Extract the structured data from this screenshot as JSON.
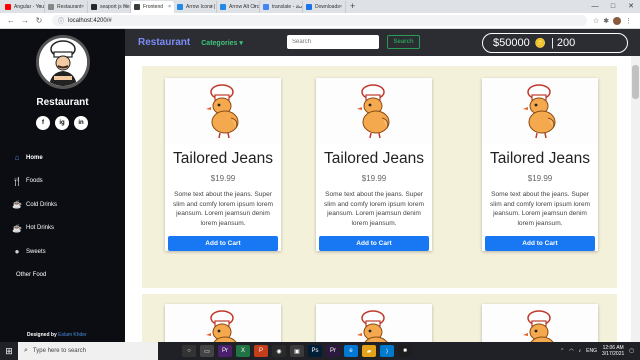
{
  "browser": {
    "tabs": [
      {
        "title": "Angular - YouTube",
        "color": "#ff0000"
      },
      {
        "title": "Restaurant",
        "color": "#888888"
      },
      {
        "title": "seaport js files - bo",
        "color": "#24292e"
      },
      {
        "title": "Frontend",
        "color": "#3c3c3c",
        "active": true
      },
      {
        "title": "Arrow Icons | Font",
        "color": "#228ae6"
      },
      {
        "title": "Arrow Alt Circle Le",
        "color": "#228ae6"
      },
      {
        "title": "translate - بحث Go",
        "color": "#4285f4"
      },
      {
        "title": "Downloads",
        "color": "#1a73e8"
      }
    ],
    "new_tab": "+",
    "url": "localhost:4200/#"
  },
  "sidebar": {
    "brand": "Restaurant",
    "socials": [
      "f",
      "ig",
      "in"
    ],
    "menu": [
      {
        "label": "Home",
        "icon": "home-icon",
        "glyph": "⌂",
        "active": true
      },
      {
        "label": "Foods",
        "icon": "utensils-icon",
        "glyph": "🍴"
      },
      {
        "label": "Cold Drinks",
        "icon": "cup-icon",
        "glyph": "☕"
      },
      {
        "label": "Hot Drinks",
        "icon": "mug-icon",
        "glyph": "☕"
      },
      {
        "label": "Sweets",
        "icon": "cookie-icon",
        "glyph": "●"
      },
      {
        "label": "Other Food",
        "icon": "",
        "glyph": ""
      }
    ],
    "credit_prefix": "Designed by",
    "credit_name": "Eslam Khder"
  },
  "navbar": {
    "app_name": "Restaurant",
    "categories_label": "Categories",
    "search_placeholder": "Search",
    "search_button": "Search",
    "balance": "$50000",
    "points": "| 200"
  },
  "products": [
    {
      "title": "Tailored Jeans",
      "price": "$19.99",
      "description": "Some text about the jeans. Super slim and comfy lorem ipsum lorem jeansum. Lorem jeamsun denim lorem jeansum.",
      "button": "Add to Cart"
    },
    {
      "title": "Tailored Jeans",
      "price": "$19.99",
      "description": "Some text about the jeans. Super slim and comfy lorem ipsum lorem jeansum. Lorem jeamsun denim lorem jeansum.",
      "button": "Add to Cart"
    },
    {
      "title": "Tailored Jeans",
      "price": "$19.99",
      "description": "Some text about the jeans. Super slim and comfy lorem ipsum lorem jeansum. Lorem jeamsun denim lorem jeansum.",
      "button": "Add to Cart"
    }
  ],
  "taskbar": {
    "search_placeholder": "Type here to search",
    "time": "12:06 AM",
    "date": "3/17/2021",
    "language": "ENG"
  },
  "colors": {
    "accent": "#1877f2",
    "brand": "#7d8cf5",
    "categories": "#3fc47a",
    "grid_bg": "#f4f1db"
  }
}
